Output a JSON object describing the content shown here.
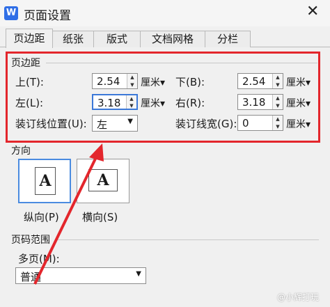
{
  "window": {
    "icon_text": "W",
    "title": "页面设置",
    "close_glyph": "✕"
  },
  "tabs": [
    {
      "label": "页边距",
      "active": true
    },
    {
      "label": "纸张",
      "active": false
    },
    {
      "label": "版式",
      "active": false
    },
    {
      "label": "文档网格",
      "active": false
    },
    {
      "label": "分栏",
      "active": false
    }
  ],
  "margins": {
    "group_label": "页边距",
    "top_label": "上(T):",
    "top_value": "2.54",
    "bottom_label": "下(B):",
    "bottom_value": "2.54",
    "left_label": "左(L):",
    "left_value": "3.18",
    "right_label": "右(R):",
    "right_value": "3.18",
    "unit": "厘米▾",
    "gutter_pos_label": "装订线位置(U):",
    "gutter_pos_value": "左",
    "gutter_width_label": "装订线宽(G):",
    "gutter_width_value": "0"
  },
  "orientation": {
    "group_label": "方向",
    "portrait_label": "纵向(P)",
    "landscape_label": "横向(S)",
    "page_letter": "A"
  },
  "page_range": {
    "group_label": "页码范围",
    "multi_label": "多页(M):",
    "multi_value": "普通"
  },
  "watermark": "@小辉打玩",
  "colors": {
    "highlight": "#e3262c",
    "focus": "#3b78d8",
    "app_icon": "#2f6ee6"
  },
  "icons": [
    "close-icon",
    "spin-up-icon",
    "spin-down-icon",
    "dropdown-arrow-icon",
    "page-portrait-icon",
    "page-landscape-icon",
    "annotation-arrow"
  ]
}
